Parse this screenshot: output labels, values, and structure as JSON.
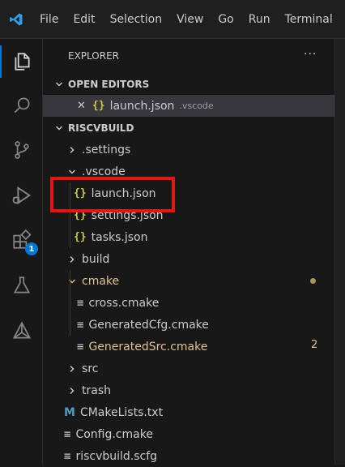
{
  "menu": [
    "File",
    "Edit",
    "Selection",
    "View",
    "Go",
    "Run",
    "Terminal"
  ],
  "activity": {
    "items": [
      "explorer-icon",
      "search-icon",
      "source-control-icon",
      "run-debug-icon",
      "extensions-icon",
      "testing-icon",
      "cmake-icon"
    ],
    "extensions_badge": "1"
  },
  "explorer": {
    "title": "EXPLORER",
    "more": "···",
    "open_editors": {
      "label": "OPEN EDITORS",
      "items": [
        {
          "icon": "{}",
          "name": "launch.json",
          "desc": ".vscode"
        }
      ]
    },
    "workspace": {
      "label": "RISCVBUILD",
      "tree": {
        "settings": ".settings",
        "vscode": ".vscode",
        "launch": "launch.json",
        "settings_json": "settings.json",
        "tasks": "tasks.json",
        "build": "build",
        "cmake": "cmake",
        "cross": "cross.cmake",
        "gencfg": "GeneratedCfg.cmake",
        "gensrc": "GeneratedSrc.cmake",
        "gensrc_count": "2",
        "src": "src",
        "trash": "trash",
        "cmakelists": "CMakeLists.txt",
        "config": "Config.cmake",
        "scfg": "riscvbuild.scfg"
      }
    }
  },
  "colors": {
    "accent": "#0078d4",
    "highlight_box": "#e81414",
    "json_icon": "#cbcb41",
    "modified": "#e2c08d"
  }
}
